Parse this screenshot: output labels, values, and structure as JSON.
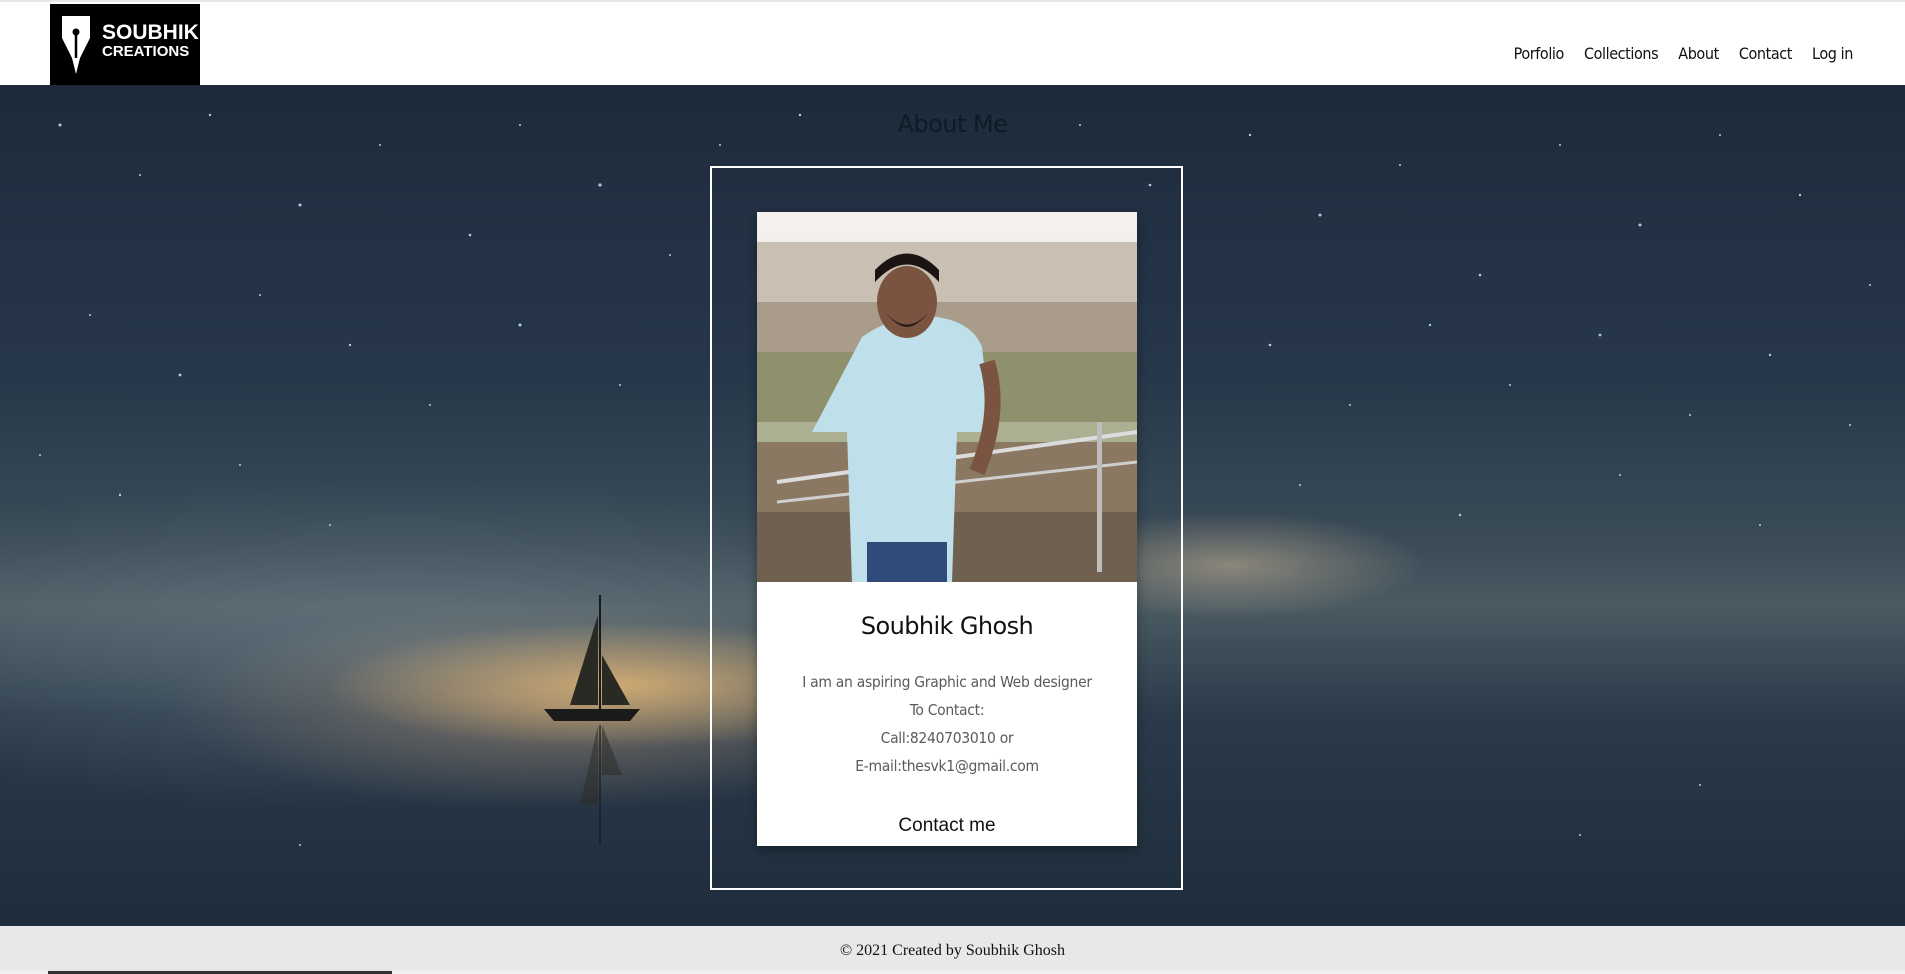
{
  "brand": {
    "line1": "SOUBHIK",
    "line2": "CREATIONS",
    "icon": "pen-nib-icon"
  },
  "nav": {
    "items": [
      "Porfolio",
      "Collections",
      "About",
      "Contact",
      "Log in"
    ]
  },
  "page": {
    "heading": "About Me"
  },
  "card": {
    "name": "Soubhik Ghosh",
    "bio": "I am an aspiring Graphic and Web designer",
    "contact_label": "To Contact:",
    "phone": "Call:8240703010 or",
    "email": "E-mail:thesvk1@gmail.com",
    "button_label": "Contact me"
  },
  "footer": {
    "text": "© 2021 Created by Soubhik Ghosh"
  },
  "colors": {
    "header_bg": "#ffffff",
    "logo_bg": "#000000",
    "card_bg": "#ffffff",
    "footer_bg": "#e8e8e8"
  }
}
